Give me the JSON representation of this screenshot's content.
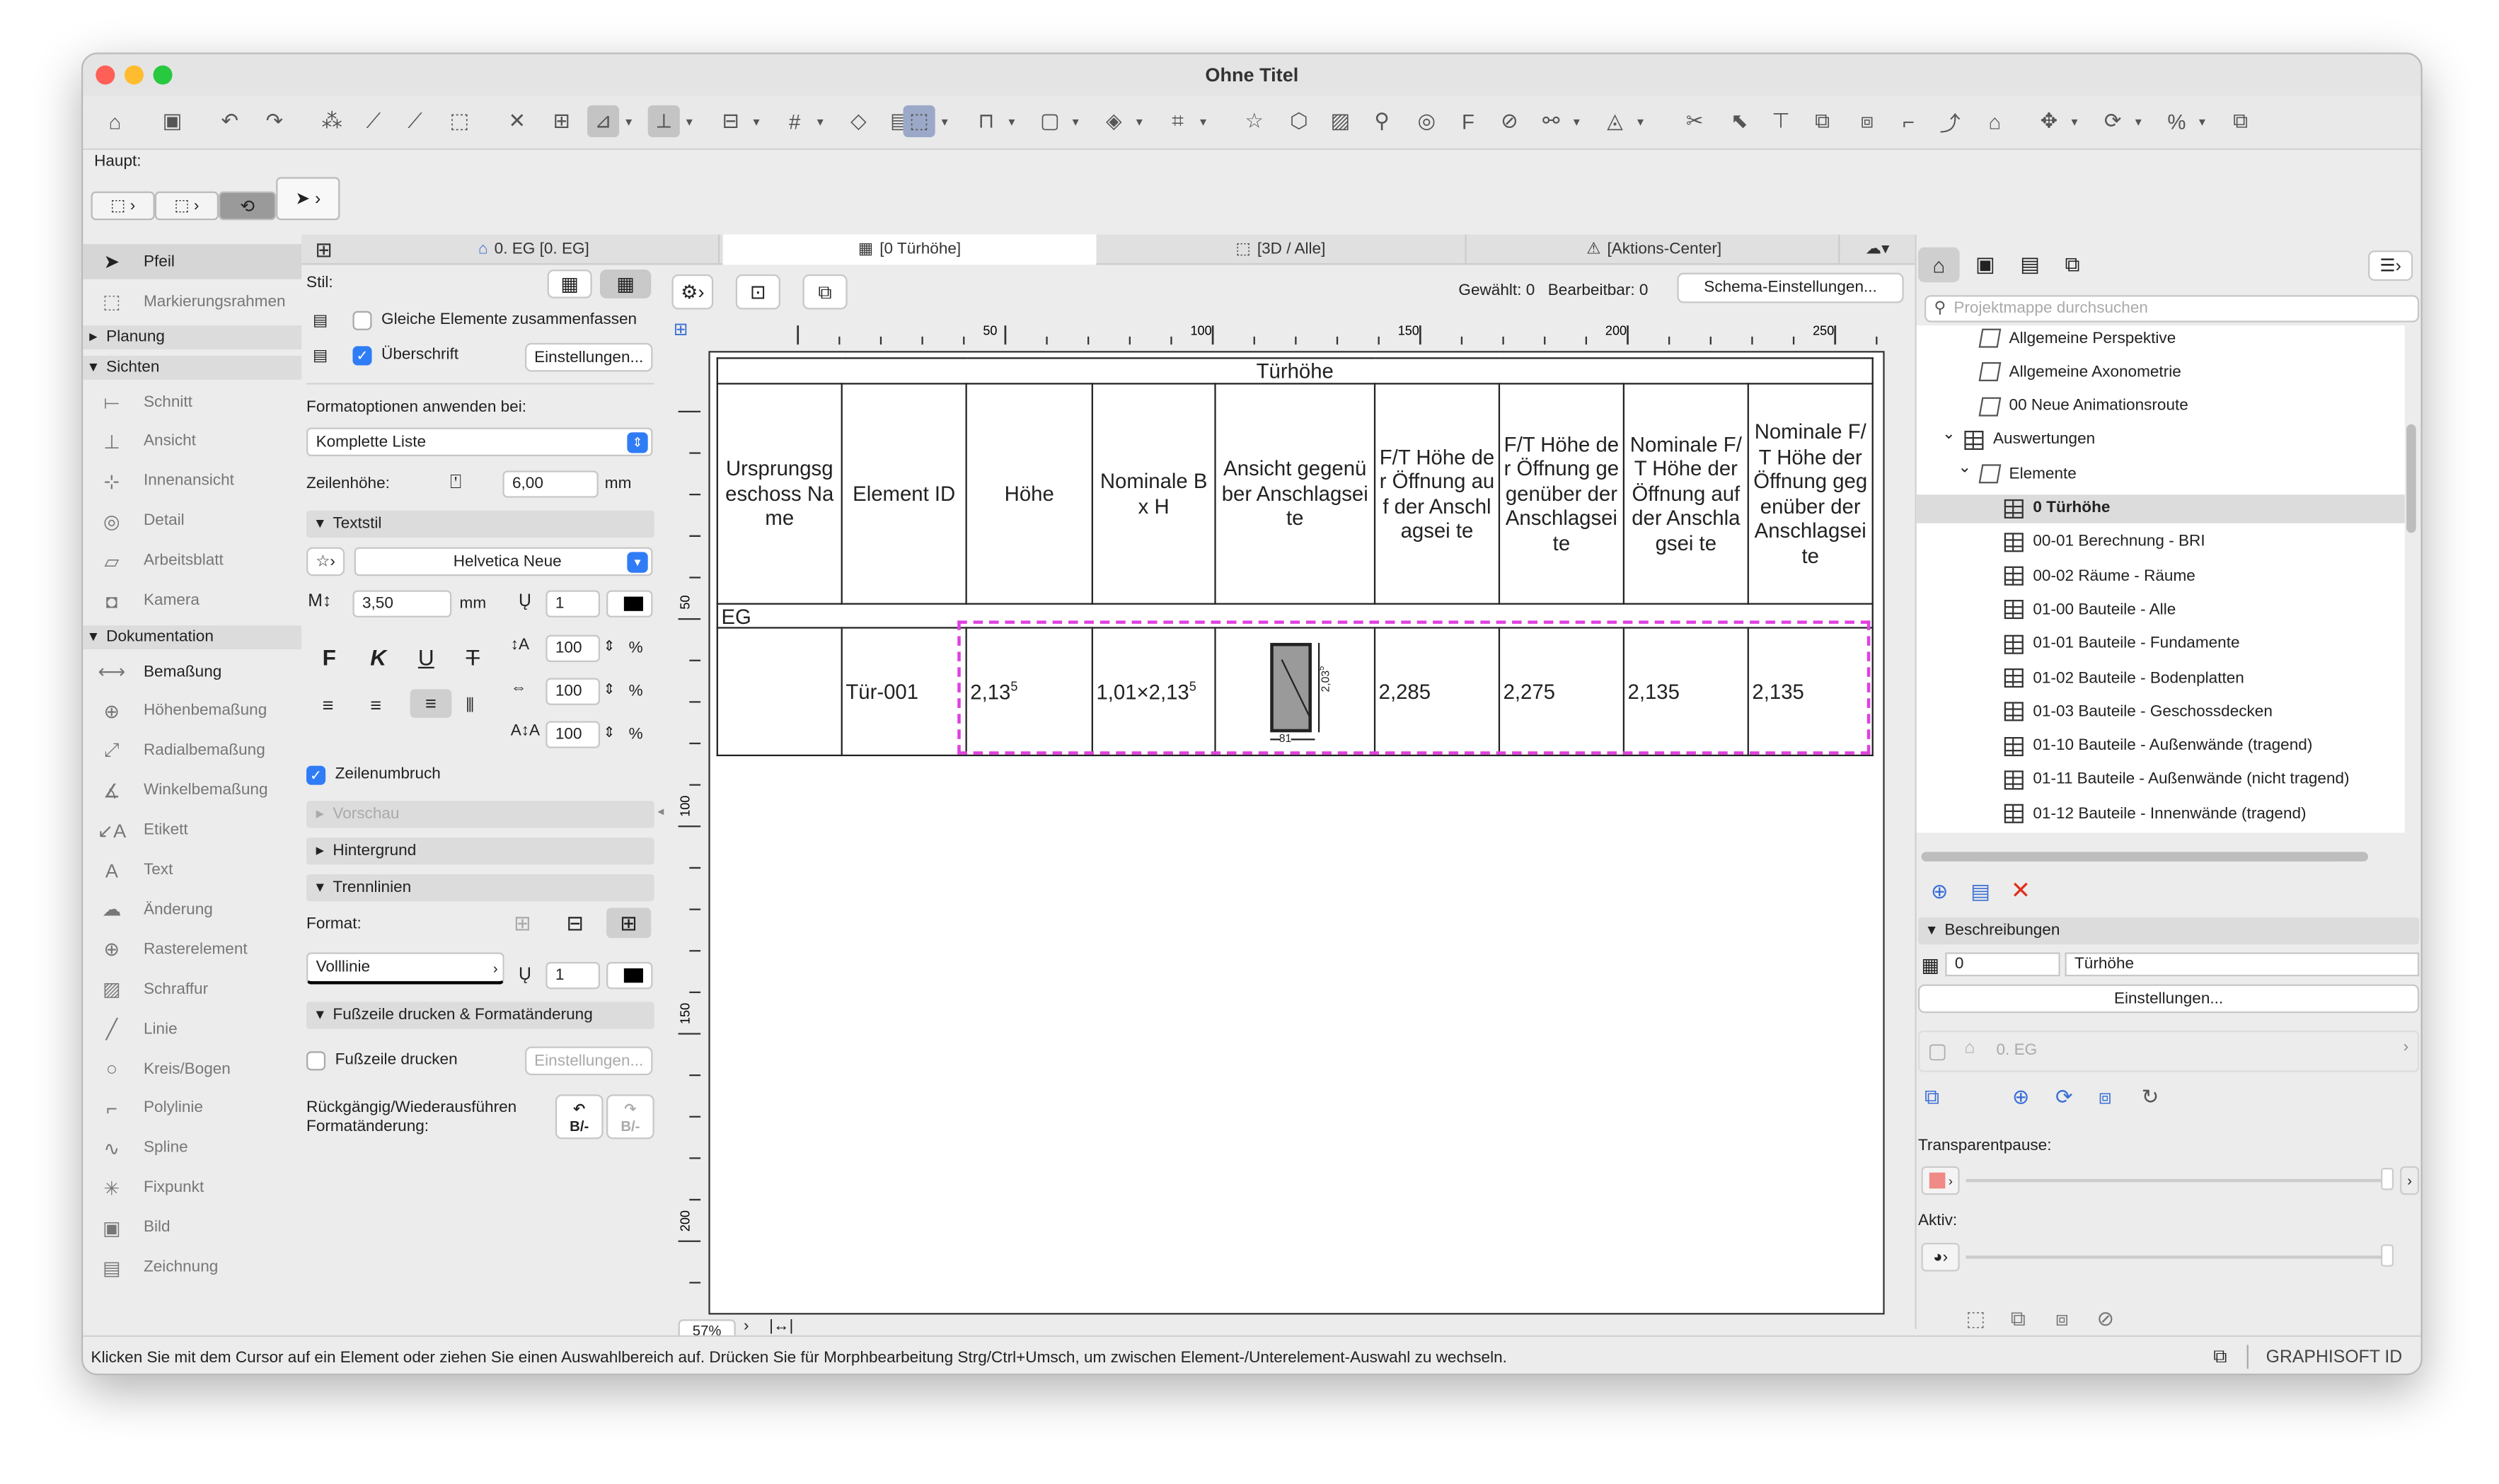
{
  "window": {
    "title": "Ohne Titel"
  },
  "palette": {
    "label": "Haupt:"
  },
  "left_tools": {
    "top": [
      {
        "label": "Pfeil",
        "icon": "arrow-icon"
      },
      {
        "label": "Markierungsrahmen",
        "icon": "marquee-icon"
      }
    ],
    "sections": {
      "planung": "Planung",
      "sichten": "Sichten",
      "dokumentation": "Dokumentation"
    },
    "sichten": [
      {
        "label": "Schnitt",
        "icon": "section-icon"
      },
      {
        "label": "Ansicht",
        "icon": "elevation-icon"
      },
      {
        "label": "Innenansicht",
        "icon": "interior-elevation-icon"
      },
      {
        "label": "Detail",
        "icon": "detail-icon"
      },
      {
        "label": "Arbeitsblatt",
        "icon": "worksheet-icon"
      },
      {
        "label": "Kamera",
        "icon": "camera-icon"
      }
    ],
    "dokumentation": [
      {
        "label": "Bemaßung",
        "icon": "dimension-icon"
      },
      {
        "label": "Höhenbemaßung",
        "icon": "level-dimension-icon"
      },
      {
        "label": "Radialbemaßung",
        "icon": "radial-dimension-icon"
      },
      {
        "label": "Winkelbemaßung",
        "icon": "angle-dimension-icon"
      },
      {
        "label": "Etikett",
        "icon": "label-icon"
      },
      {
        "label": "Text",
        "icon": "text-icon"
      },
      {
        "label": "Änderung",
        "icon": "change-icon"
      },
      {
        "label": "Rasterelement",
        "icon": "grid-element-icon"
      },
      {
        "label": "Schraffur",
        "icon": "fill-icon"
      },
      {
        "label": "Linie",
        "icon": "line-icon"
      },
      {
        "label": "Kreis/Bogen",
        "icon": "circle-icon"
      },
      {
        "label": "Polylinie",
        "icon": "polyline-icon"
      },
      {
        "label": "Spline",
        "icon": "spline-icon"
      },
      {
        "label": "Fixpunkt",
        "icon": "hotspot-icon"
      },
      {
        "label": "Bild",
        "icon": "image-icon"
      },
      {
        "label": "Zeichnung",
        "icon": "drawing-icon"
      }
    ]
  },
  "format_panel": {
    "stil": "Stil:",
    "gleiche": "Gleiche Elemente zusammenfassen",
    "ueberschrift": "Überschrift",
    "einstellungen": "Einstellungen...",
    "formatoptionen": "Formatoptionen anwenden bei:",
    "komplette": "Komplette Liste",
    "zeilenhoehe": "Zeilenhöhe:",
    "zeilenhoehe_value": "6,00",
    "mm": "mm",
    "textstil": "Textstil",
    "font": "Helvetica Neue",
    "size": "3,50",
    "pen": "1",
    "pct1": "100",
    "pct2": "100",
    "pct3": "100",
    "pct": "%",
    "bold": "F",
    "italic": "K",
    "underline": "U",
    "strike": "T",
    "zeilenumbruch": "Zeilenumbruch",
    "vorschau": "Vorschau",
    "hintergrund": "Hintergrund",
    "trennlinien": "Trennlinien",
    "format": "Format:",
    "linetype": "Volllinie",
    "line_pen": "1",
    "fusszeile_section": "Fußzeile drucken & Formatänderung",
    "fusszeile": "Fußzeile drucken",
    "fusszeile_einst": "Einstellungen...",
    "rueckgaengig": "Rückgängig/Wiederausführen Formatänderung:",
    "undo_glyph": "B/-",
    "redo_glyph": "B/-"
  },
  "tabs": [
    {
      "label": "0. EG [0. EG]",
      "icon": "floor-plan-icon"
    },
    {
      "label": "[0 Türhöhe]",
      "icon": "schedule-icon"
    },
    {
      "label": "[3D / Alle]",
      "icon": "3d-icon"
    },
    {
      "label": "[Aktions-Center]",
      "icon": "action-center-icon"
    }
  ],
  "schedule": {
    "gewaehlt": "Gewählt: 0",
    "bearbeitbar": "Bearbeitbar: 0",
    "schema": "Schema-Einstellungen...",
    "ruler_labels": [
      "50",
      "100",
      "150",
      "200",
      "250"
    ],
    "vruler_labels": [
      "50",
      "100",
      "150",
      "200"
    ],
    "title": "Türhöhe",
    "headers": [
      "Ursprungsg eschoss Name",
      "Element ID",
      "Höhe",
      "Nominale B x H",
      "Ansicht gegenüber Anschlagseite",
      "F/T Höhe der Öffnung auf der Anschlagsei te",
      "F/T Höhe der Öffnung gegenüber der Anschlagsei te",
      "Nominale F/ T Höhe der Öffnung auf der Anschlagsei te",
      "Nominale F/ T Höhe der Öffnung gegenüber der Anschlagsei te"
    ],
    "group": "EG",
    "row": {
      "element_id": "Tür-001",
      "hoehe_main": "2,13",
      "hoehe_sup": "5",
      "nom_main": "1,01×2,13",
      "nom_sup": "5",
      "v1": "2,285",
      "v2": "2,275",
      "v3": "2,135",
      "v4": "2,135"
    },
    "door_dim_v": "2,03",
    "door_dim_v_sup": "5",
    "door_dim_h": "81",
    "zoom": "57%"
  },
  "right_panel": {
    "search_placeholder": "Projektmappe durchsuchen",
    "tree": [
      {
        "label": "Allgemeine Perspektive",
        "indent": 40,
        "icon": "perspective-icon"
      },
      {
        "label": "Allgemeine Axonometrie",
        "indent": 40,
        "icon": "axonometry-icon"
      },
      {
        "label": "00 Neue Animationsroute",
        "indent": 40,
        "icon": "animation-icon"
      },
      {
        "label": "Auswertungen",
        "indent": 30,
        "icon": "schedule-icon",
        "arrow": "⌄"
      },
      {
        "label": "Elemente",
        "indent": 40,
        "icon": "elements-icon",
        "arrow": "⌄"
      },
      {
        "label": "0 Türhöhe",
        "indent": 55,
        "icon": "schedule-icon",
        "selected": true
      },
      {
        "label": "00-01 Berechnung - BRI",
        "indent": 55,
        "icon": "schedule-icon"
      },
      {
        "label": "00-02 Räume - Räume",
        "indent": 55,
        "icon": "schedule-icon"
      },
      {
        "label": "01-00 Bauteile - Alle",
        "indent": 55,
        "icon": "schedule-icon"
      },
      {
        "label": "01-01 Bauteile - Fundamente",
        "indent": 55,
        "icon": "schedule-icon"
      },
      {
        "label": "01-02 Bauteile - Bodenplatten",
        "indent": 55,
        "icon": "schedule-icon"
      },
      {
        "label": "01-03 Bauteile - Geschossdecken",
        "indent": 55,
        "icon": "schedule-icon"
      },
      {
        "label": "01-10 Bauteile - Außenwände (tragend)",
        "indent": 55,
        "icon": "schedule-icon"
      },
      {
        "label": "01-11 Bauteile - Außenwände (nicht tragend)",
        "indent": 55,
        "icon": "schedule-icon"
      },
      {
        "label": "01-12 Bauteile - Innenwände (tragend)",
        "indent": 55,
        "icon": "schedule-icon"
      }
    ],
    "beschreibungen": "Beschreibungen",
    "id_value": "0",
    "name_value": "Türhöhe",
    "einstellungen": "Einstellungen...",
    "layer": "0. EG",
    "transparentpause": "Transparentpause:",
    "aktiv": "Aktiv:"
  },
  "status": {
    "text": "Klicken Sie mit dem Cursor auf ein Element oder ziehen Sie einen Auswahlbereich auf. Drücken Sie für Morphbearbeitung Strg/Ctrl+Umsch, um zwischen Element-/Unterelement-Auswahl zu wechseln.",
    "brand": "GRAPHISOFT ID"
  },
  "colors": {
    "accent": "#2f7cf6",
    "selection": "#e040e0",
    "red_x": "#e0301e"
  }
}
